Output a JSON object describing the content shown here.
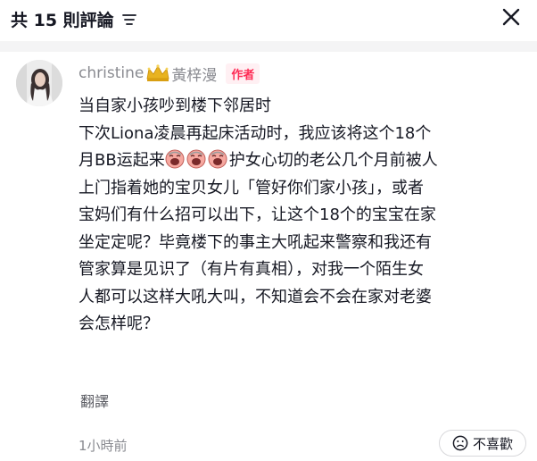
{
  "header": {
    "title": "共 15 則評論",
    "sort_icon": "sort-lines-icon",
    "close_icon": "close-icon"
  },
  "comment": {
    "author_name": "christine",
    "author_icon": "crown-icon",
    "author_name_2": "黃梓漫",
    "author_badge": "作者",
    "lines": [
      "当自家小孩吵到楼下邻居时",
      "下次Liona凌晨再起床活动时，我应该将这个18个",
      "月BB运起来",
      "护女心切的老公几个月前被人",
      "上门指着她的宝贝女儿「管好你们家小孩」，或者",
      "宝妈们有什么招可以出下，让这个18个的宝宝在家",
      "坐定定呢？毕竟楼下的事主大吼起来警察和我还有",
      "管家算是见识了（有片有真相），对我一个陌生女",
      "人都可以这样大吼大叫，不知道会不会在家对老婆",
      "会怎样呢？"
    ],
    "emoji_icon": "crying-face-emoji",
    "translate_label": "翻譯",
    "timestamp": "1小時前",
    "dislike_label": "不喜歡",
    "dislike_icon": "sad-face-icon"
  },
  "colors": {
    "accent": "#fe2c55",
    "muted": "#8a8b91",
    "text": "#161823",
    "divider": "#f4f4f5"
  }
}
